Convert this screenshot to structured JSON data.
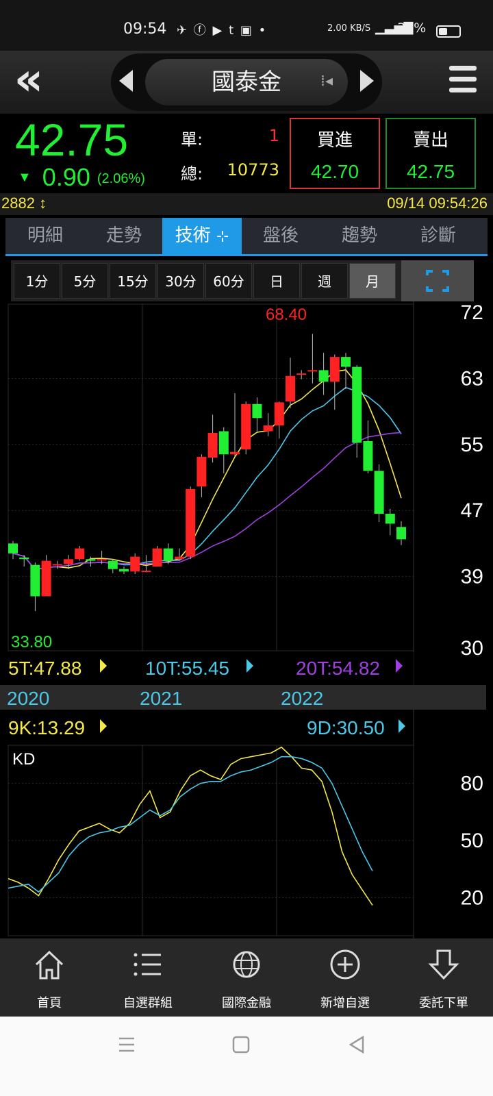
{
  "status": {
    "time": "09:54",
    "net_speed": "2.00 KB/S",
    "battery": "38%"
  },
  "header": {
    "stock_name": "國泰金"
  },
  "quote": {
    "price": "42.75",
    "change": "0.90",
    "change_pct": "(2.06%)",
    "single_label": "單:",
    "single_value": "1",
    "total_label": "總:",
    "total_value": "10773",
    "buy_label": "買進",
    "buy_price": "42.70",
    "sell_label": "賣出",
    "sell_price": "42.75"
  },
  "info": {
    "code": "2882",
    "datetime": "09/14 09:54:26"
  },
  "tabs": [
    "明細",
    "走勢",
    "技術",
    "盤後",
    "趨勢",
    "診斷"
  ],
  "periods": [
    "1分",
    "5分",
    "15分",
    "30分",
    "60分",
    "日",
    "週",
    "月"
  ],
  "colors": {
    "up": "#ff2222",
    "down": "#22ee33",
    "ma5": "#f5e84a",
    "ma10": "#4cc8e8",
    "ma20": "#a040e0",
    "accent": "#1e9ae6"
  },
  "indicators": {
    "ma5": "5T:47.88",
    "ma10": "10T:55.45",
    "ma20": "20T:54.82",
    "k": "9K:13.29",
    "d": "9D:30.50",
    "kd_title": "KD",
    "max_label": "68.40",
    "min_label": "33.80"
  },
  "chart_data": [
    {
      "type": "candlestick",
      "period": "月",
      "x_labels": [
        "2020",
        "2021",
        "2022"
      ],
      "y_ticks": [
        30,
        39,
        47,
        55,
        63,
        72
      ],
      "ylim": [
        30,
        72
      ],
      "candles": [
        [
          43.0,
          43.3,
          41.1,
          41.8
        ],
        [
          41.3,
          41.6,
          40.2,
          41.1
        ],
        [
          40.4,
          40.7,
          34.8,
          36.6
        ],
        [
          36.6,
          41.6,
          36.6,
          40.9
        ],
        [
          40.5,
          40.9,
          39.9,
          40.5
        ],
        [
          40.5,
          41.6,
          39.9,
          41.1
        ],
        [
          41.1,
          42.7,
          40.9,
          42.4
        ],
        [
          41.1,
          41.4,
          40.2,
          40.9
        ],
        [
          41.1,
          42.1,
          40.5,
          41.1
        ],
        [
          40.9,
          41.1,
          39.4,
          39.9
        ],
        [
          39.9,
          40.2,
          39.3,
          39.6
        ],
        [
          39.6,
          41.8,
          39.3,
          41.4
        ],
        [
          39.6,
          41.6,
          39.5,
          39.7
        ],
        [
          40.2,
          42.7,
          40.2,
          42.4
        ],
        [
          42.4,
          43.0,
          40.5,
          40.9
        ],
        [
          41.1,
          42.4,
          40.9,
          41.4
        ],
        [
          41.4,
          49.9,
          41.1,
          49.6
        ],
        [
          49.9,
          53.8,
          48.6,
          53.5
        ],
        [
          53.4,
          58.6,
          52.8,
          56.4
        ],
        [
          56.6,
          57.1,
          51.5,
          53.8
        ],
        [
          53.8,
          61.2,
          53.5,
          54.1
        ],
        [
          54.4,
          60.2,
          53.8,
          59.9
        ],
        [
          59.9,
          60.7,
          56.6,
          58.2
        ],
        [
          56.6,
          58.8,
          56.0,
          57.3
        ],
        [
          57.3,
          60.2,
          55.7,
          60.1
        ],
        [
          60.2,
          65.5,
          59.4,
          63.3
        ],
        [
          63.6,
          64.0,
          62.9,
          63.6
        ],
        [
          63.9,
          68.4,
          62.4,
          64.0
        ],
        [
          64.0,
          66.1,
          61.0,
          62.6
        ],
        [
          62.6,
          65.9,
          59.2,
          65.6
        ],
        [
          65.6,
          66.1,
          61.7,
          64.4
        ],
        [
          64.4,
          64.6,
          53.4,
          55.2
        ],
        [
          55.4,
          57.9,
          51.5,
          51.8
        ],
        [
          51.8,
          52.6,
          45.6,
          46.6
        ],
        [
          46.6,
          47.2,
          44.0,
          45.4
        ],
        [
          45.0,
          45.7,
          42.8,
          43.5
        ]
      ]
    },
    {
      "type": "line",
      "title": "KD",
      "y_ticks": [
        20,
        50,
        80
      ],
      "ylim": [
        0,
        100
      ],
      "series": [
        {
          "name": "9K",
          "values": [
            30,
            28,
            25,
            21,
            30,
            40,
            48,
            55,
            57,
            59,
            56,
            54,
            59,
            69,
            76,
            62,
            65,
            76,
            84,
            87,
            84,
            82,
            90,
            93,
            94,
            95,
            96,
            99,
            94,
            88,
            87,
            81,
            65,
            44,
            32,
            24,
            16
          ]
        },
        {
          "name": "9D",
          "values": [
            25,
            26,
            27,
            23,
            28,
            33,
            42,
            48,
            52,
            54,
            55,
            57,
            58,
            62,
            66,
            63,
            66,
            73,
            77,
            80,
            81,
            81,
            84,
            86,
            87,
            89,
            91,
            94,
            94,
            93,
            91,
            88,
            80,
            68,
            56,
            44,
            34
          ]
        }
      ]
    }
  ],
  "bottom_nav": [
    "首頁",
    "自選群組",
    "國際金融",
    "新增自選",
    "委託下單"
  ]
}
